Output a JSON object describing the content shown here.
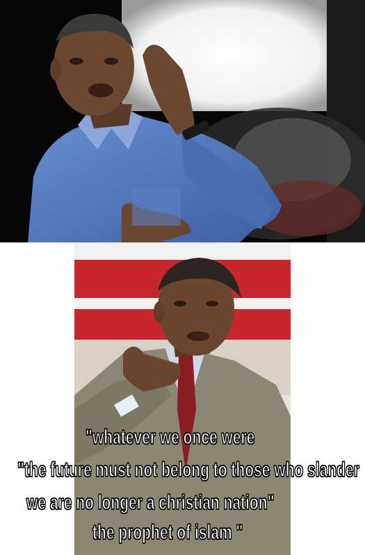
{
  "caption": {
    "line1": "\"whatever we once were",
    "line2": "\"the future must not belong to those who slander",
    "line3": "we are no longer a christian nation\"",
    "line4": "the prophet of islam \""
  },
  "colors": {
    "caption_text": "#ffffff",
    "caption_outline": "#000000",
    "top_background": "#050505",
    "shirt_blue": "#4e74b8",
    "banner_red": "#c8262d",
    "suit_tan": "#8c8775"
  }
}
